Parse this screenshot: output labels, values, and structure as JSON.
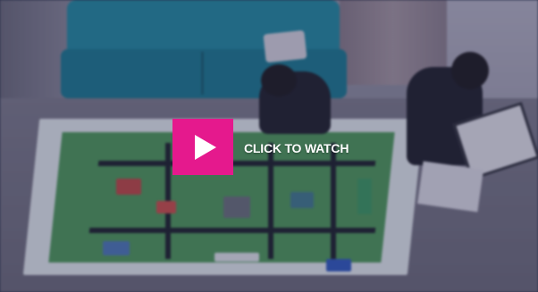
{
  "video": {
    "cta_label": "CLICK TO WATCH",
    "play_icon": "play-icon",
    "colors": {
      "play_button": "#e5198d",
      "label": "#ffffff",
      "overlay_tint": "#282c50"
    }
  }
}
